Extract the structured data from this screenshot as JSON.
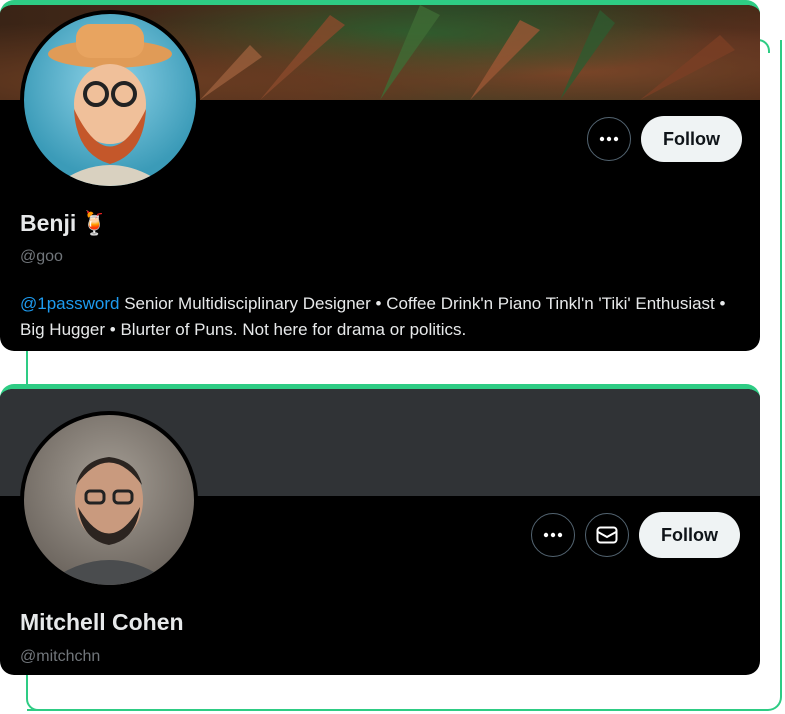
{
  "colors": {
    "accent": "#2ecc84",
    "card_bg": "#000000",
    "mention": "#1d9bf0",
    "handle": "#71767b"
  },
  "profiles": [
    {
      "name": "Benji",
      "name_emoji": "🍹",
      "handle": "@goo",
      "bio_mention": "@1password",
      "bio_text": " Senior Multidisciplinary Designer • Coffee Drink'n Piano Tinkl'n 'Tiki' Enthusiast • Big Hugger • Blurter of Puns. Not here for drama or politics.",
      "more_icon": "more-icon",
      "follow_label": "Follow"
    },
    {
      "name": "Mitchell Cohen",
      "handle": "@mitchchn",
      "more_icon": "more-icon",
      "message_icon": "mail-icon",
      "follow_label": "Follow"
    }
  ]
}
